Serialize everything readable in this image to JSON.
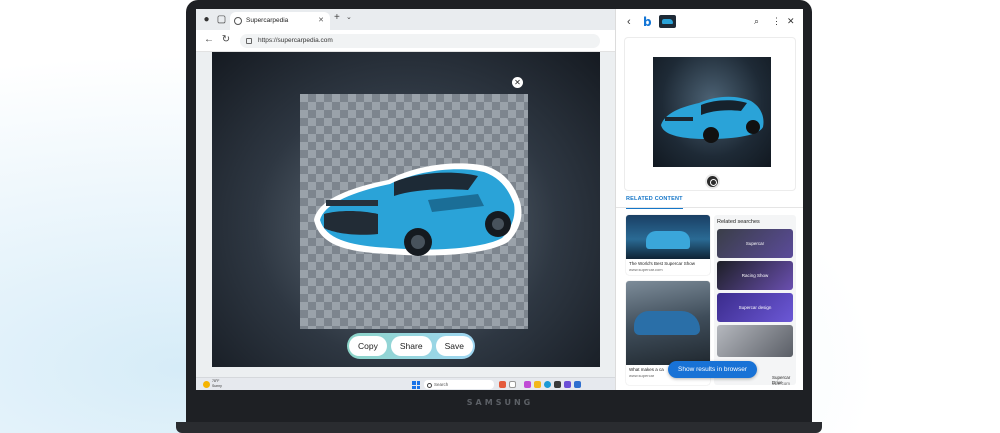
{
  "device": {
    "brand": "SAMSUNG"
  },
  "browser": {
    "tab_title": "Supercarpedia",
    "url": "https://supercarpedia.com"
  },
  "image_actions": {
    "copy": "Copy",
    "share": "Share",
    "save": "Save"
  },
  "taskbar": {
    "weather_temp": "78°F",
    "weather_desc": "Sunny",
    "search_placeholder": "Search"
  },
  "sidebar": {
    "related_tab": "RELATED CONTENT",
    "results": [
      {
        "title": "The World's Best Supercar Show",
        "source": "www.supercar.com"
      },
      {
        "title": "What makes a ca",
        "source": "www.supercar"
      }
    ],
    "related_searches_title": "Related searches",
    "related_searches": [
      {
        "label": "Supercar"
      },
      {
        "label": "Racing Show"
      },
      {
        "label": "Supercar design"
      },
      {
        "label": ""
      }
    ],
    "bottom_right_caption": "Supercar Drive",
    "bottom_right_source": "owe.com",
    "show_results_button": "Show results in browser"
  },
  "colors": {
    "accent": "#1872d6",
    "car_blue": "#2aa3d8"
  }
}
